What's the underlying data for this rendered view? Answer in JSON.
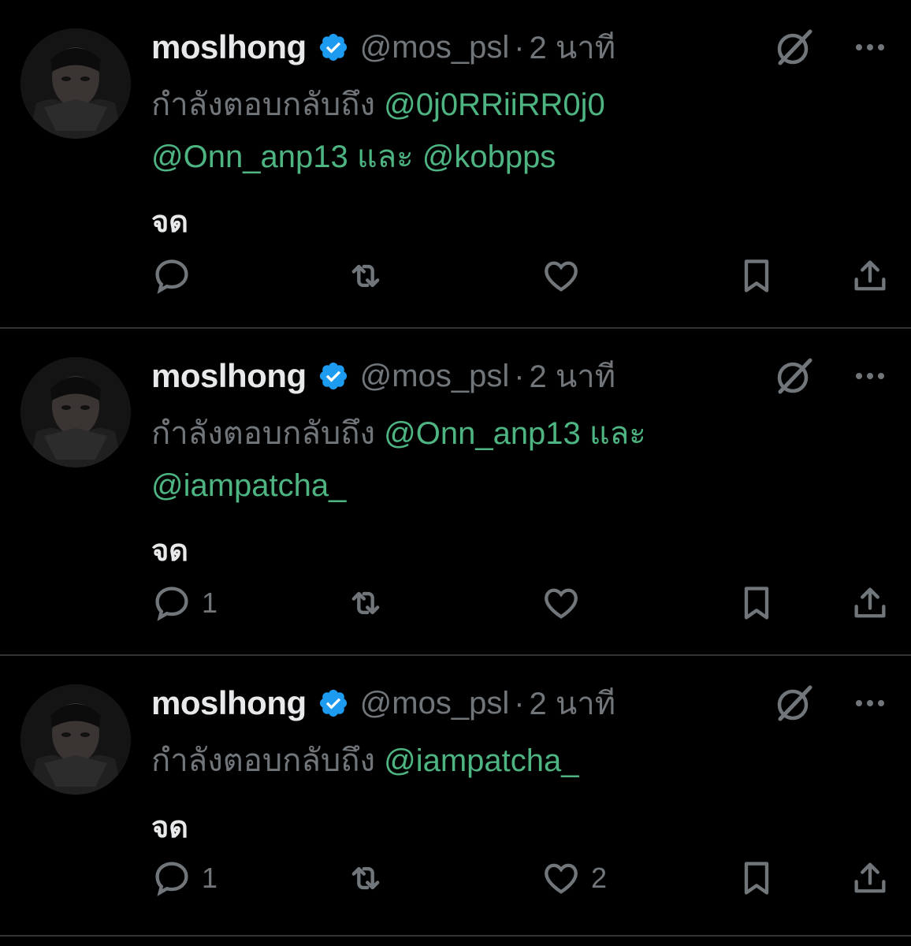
{
  "colors": {
    "background": "#000000",
    "text": "#e7e9ea",
    "muted": "#71767b",
    "mention": "#4db482",
    "verified": "#1d9bf0",
    "divider": "#2f3336"
  },
  "tweets": [
    {
      "name": "moslhong",
      "handle": "@mos_psl",
      "dot": "·",
      "time": "2 นาที",
      "reply_prefix": "กำลังตอบกลับถึง",
      "mentions": [
        "@0j0RRiiRR0j0",
        "@Onn_anp13",
        "@kobpps"
      ],
      "and": "และ",
      "body": "จด",
      "counts": {
        "reply": "",
        "retweet": "",
        "like": ""
      },
      "icons": [
        "avatar",
        "verified-badge-icon",
        "grok-icon",
        "more-icon",
        "reply-icon",
        "retweet-icon",
        "like-icon",
        "bookmark-icon",
        "share-icon"
      ]
    },
    {
      "name": "moslhong",
      "handle": "@mos_psl",
      "dot": "·",
      "time": "2 นาที",
      "reply_prefix": "กำลังตอบกลับถึง",
      "mentions": [
        "@Onn_anp13",
        "@iampatcha_"
      ],
      "and": "และ",
      "body": "จด",
      "counts": {
        "reply": "1",
        "retweet": "",
        "like": ""
      }
    },
    {
      "name": "moslhong",
      "handle": "@mos_psl",
      "dot": "·",
      "time": "2 นาที",
      "reply_prefix": "กำลังตอบกลับถึง",
      "mentions": [
        "@iampatcha_"
      ],
      "body": "จด",
      "counts": {
        "reply": "1",
        "retweet": "",
        "like": "2"
      }
    }
  ]
}
